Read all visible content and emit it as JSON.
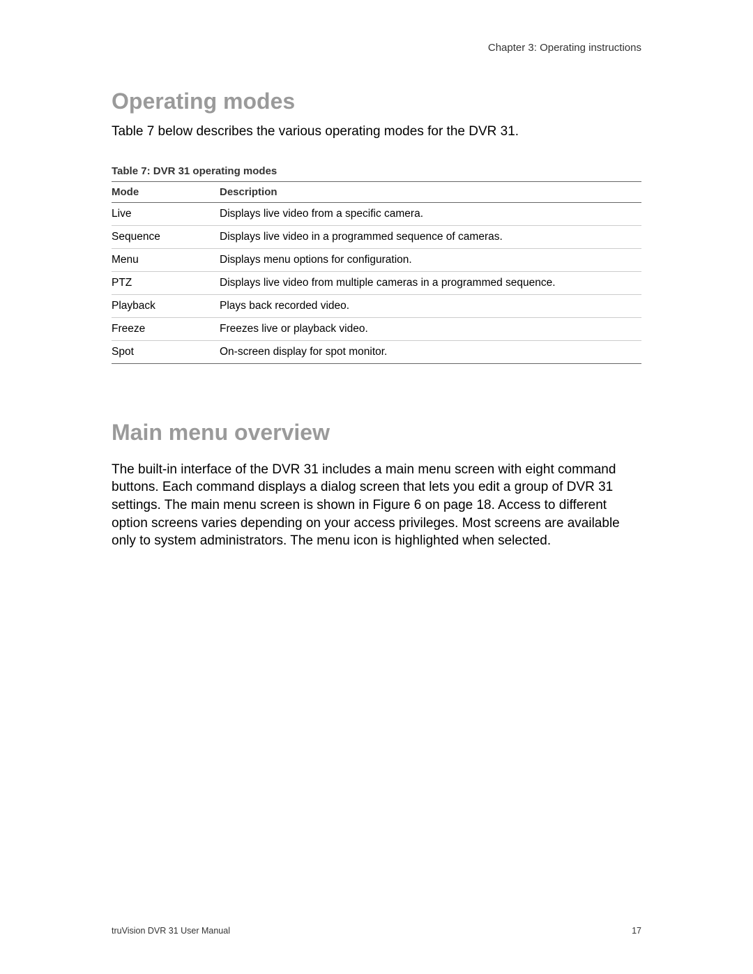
{
  "header": {
    "chapter": "Chapter 3: Operating instructions"
  },
  "section1": {
    "heading": "Operating modes",
    "intro": "Table 7 below describes the various operating modes for the DVR 31."
  },
  "table": {
    "caption": "Table 7: DVR 31 operating modes",
    "headers": {
      "mode": "Mode",
      "description": "Description"
    },
    "rows": [
      {
        "mode": "Live",
        "description": "Displays live video from a specific camera."
      },
      {
        "mode": "Sequence",
        "description": "Displays live video in a programmed sequence of cameras."
      },
      {
        "mode": "Menu",
        "description": "Displays menu options for configuration."
      },
      {
        "mode": "PTZ",
        "description": "Displays live video from multiple cameras in a programmed sequence."
      },
      {
        "mode": "Playback",
        "description": "Plays back recorded video."
      },
      {
        "mode": "Freeze",
        "description": "Freezes live or playback video."
      },
      {
        "mode": "Spot",
        "description": "On-screen display for spot monitor."
      }
    ]
  },
  "section2": {
    "heading": "Main menu overview",
    "body": "The built-in interface of the DVR 31 includes a main menu screen with eight command buttons. Each command displays a dialog screen that lets you edit a group of DVR 31 settings. The main menu screen is shown in Figure 6 on page 18. Access to different option screens varies depending on your access privileges. Most screens are available only to system administrators. The menu icon is highlighted when selected."
  },
  "footer": {
    "doc_title": "truVision DVR 31 User Manual",
    "page_number": "17"
  }
}
